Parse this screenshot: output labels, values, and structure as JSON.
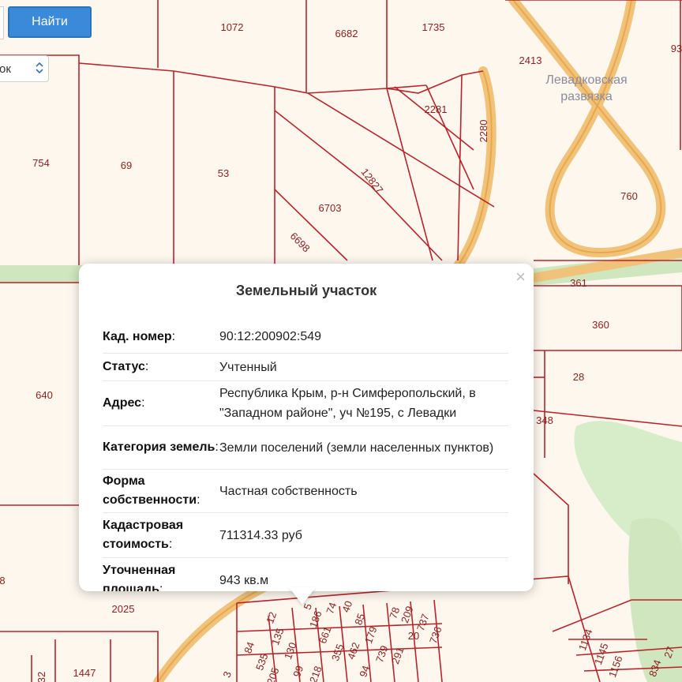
{
  "search": {
    "button_label": "Найти"
  },
  "layer_select": {
    "value": "ок"
  },
  "map": {
    "place_label": [
      "Левадковская",
      "развязка"
    ],
    "parcels": [
      "1072",
      "6682",
      "1735",
      "2413",
      "93",
      "2281",
      "2280",
      "754",
      "69",
      "53",
      "12827",
      "760",
      "6703",
      "6698",
      "361",
      "360",
      "640",
      "28",
      "348",
      "2025",
      "1447",
      "8",
      "32",
      "84",
      "535",
      "135",
      "205",
      "130",
      "99",
      "186",
      "661",
      "355",
      "462",
      "74",
      "218",
      "179",
      "94",
      "739",
      "291",
      "85",
      "209",
      "78",
      "737",
      "736",
      "1134",
      "1145",
      "1156",
      "834",
      "27",
      "20",
      "5",
      "12",
      "40",
      "3"
    ]
  },
  "popup": {
    "title": "Земельный участок",
    "close_glyph": "×",
    "rows": [
      {
        "label": "Кад. номер",
        "sep": ":",
        "value": "90:12:200902:549"
      },
      {
        "label": "Статус",
        "sep": ":",
        "value": "Учтенный"
      },
      {
        "label": "Адрес",
        "sep": ":",
        "value": "Республика Крым, р-н Симферопольский, в \"Западном районе\", уч №195, с Левадки"
      },
      {
        "label": "Категория земель",
        "sep": ":",
        "value": "Земли поселений (земли населенных пунктов)"
      },
      {
        "label": "Форма собственности",
        "sep": ":",
        "value": "Частная собственность"
      },
      {
        "label": "Кадастровая стоимость",
        "sep": ":",
        "value": "711314.33 руб"
      },
      {
        "label": "Уточненная площадь",
        "sep": ":",
        "value": "943 кв.м"
      }
    ]
  },
  "colors": {
    "parcel_line": "#b8242c",
    "road": "#f0c27a",
    "green": "#d7ecc8",
    "button": "#3b8ad9"
  }
}
